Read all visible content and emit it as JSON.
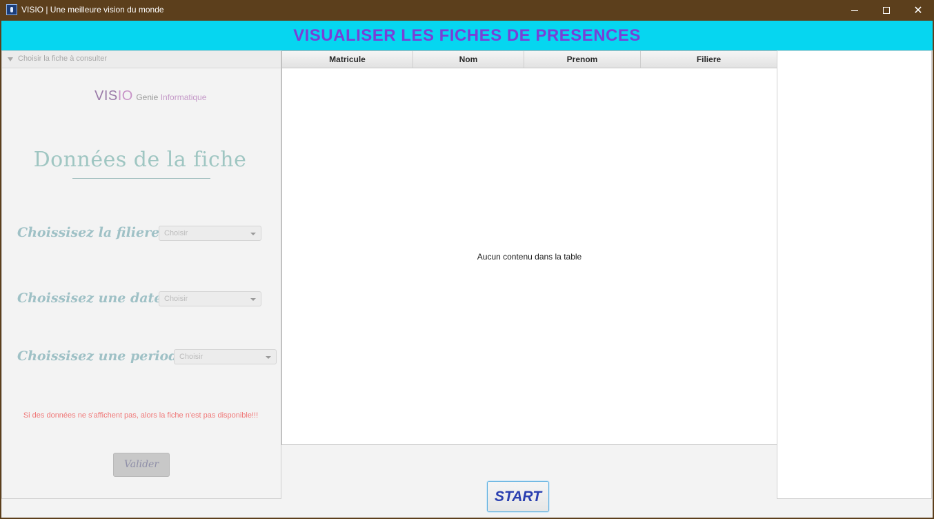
{
  "window": {
    "title": "VISIO | Une meilleure vision du monde",
    "controls": {
      "minimize": "minimize-icon",
      "maximize": "maximize-icon",
      "close": "✕"
    }
  },
  "header": {
    "title": "VISUALISER LES FICHES DE PRESENCES",
    "background_color": "#06d6f0",
    "title_color": "#7a3fd6"
  },
  "left_panel": {
    "header_title": "Choisir la fiche à consulter",
    "logo": {
      "main_prefix": "VIS",
      "main_suffix": "IO",
      "sub_prefix": "Genie ",
      "sub_suffix": "Informatique"
    },
    "section_title": "Données de la fiche",
    "fields": [
      {
        "label": "Choissisez la filiere :",
        "value": "Choisir"
      },
      {
        "label": "Choissisez une date :",
        "value": "Choisir"
      },
      {
        "label": "Choissisez une periode :",
        "value": "Choisir"
      }
    ],
    "warning": "Si des données ne s'affichent pas, alors la fiche n'est pas disponible!!!",
    "submit_label": "Valider"
  },
  "table": {
    "columns": [
      "Matricule",
      "Nom",
      "Prenom",
      "Filiere"
    ],
    "rows": [],
    "empty_message": "Aucun contenu dans la table"
  },
  "footer": {
    "start_label": "START"
  }
}
